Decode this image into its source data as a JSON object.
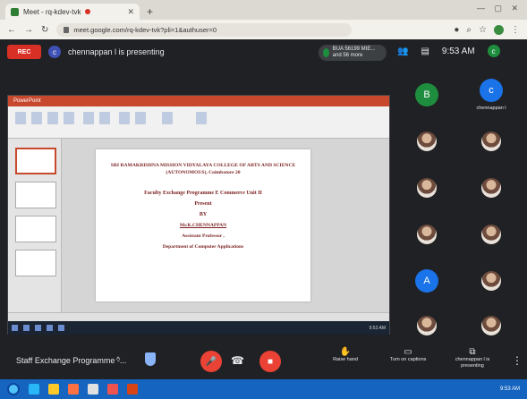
{
  "browser": {
    "tab_title": "Meet - rq-kdev-tvk",
    "new_tab": "+",
    "window_controls": "— ▢ ✕",
    "url": "meet.google.com/rq-kdev-tvk?pli=1&authuser=0"
  },
  "meet": {
    "rec_badge": "REC",
    "presenter_initial": "c",
    "presenting_text": "chennappan l is presenting",
    "participants_pill": "BUA 56199 MIE... and 56 more",
    "time": "9:53 AM",
    "me_initial": "c"
  },
  "slide": {
    "line1": "SRI RAMAKRISHNA MISSION VIDYALAYA COLLEGE OF ARTS AND SCIENCE (AUTONOMOUS), Coimbatore 20",
    "line3": "Faculty Exchange Programme E Commerce Unit II",
    "line4": "Present",
    "line5": "BY",
    "line6": "Mr.K.CHENNAPPAN",
    "line7": "Assistant Professor ,",
    "line8": "Department of Computer Applications"
  },
  "ppt": {
    "title_bar": "PowerPoint",
    "taskbar_clock": "9:53 AM"
  },
  "participants": [
    {
      "initial": "B",
      "color": "#1e8e3e",
      "name": ""
    },
    {
      "initial": "c",
      "color": "#1a73e8",
      "name": "chennappan l"
    },
    {
      "initial": "",
      "color": "",
      "name": ""
    },
    {
      "initial": "",
      "color": "",
      "name": ""
    },
    {
      "initial": "",
      "color": "",
      "name": ""
    },
    {
      "initial": "",
      "color": "",
      "name": ""
    },
    {
      "initial": "",
      "color": "",
      "name": ""
    },
    {
      "initial": "",
      "color": "",
      "name": ""
    },
    {
      "initial": "A",
      "color": "#1a73e8",
      "name": ""
    },
    {
      "initial": "",
      "color": "",
      "name": ""
    },
    {
      "initial": "",
      "color": "",
      "name": ""
    },
    {
      "initial": "",
      "color": "",
      "name": ""
    }
  ],
  "bottom": {
    "meeting_name": "Staff Exchange Programme -...",
    "caret": "^",
    "raise_hand": "Raise hand",
    "turn_on_captions": "Turn on captions",
    "presenting": "chennappan l is presenting",
    "more": "⋮",
    "hangup_icon": "phone-hangup-icon"
  },
  "os": {
    "clock": "9:53 AM"
  }
}
